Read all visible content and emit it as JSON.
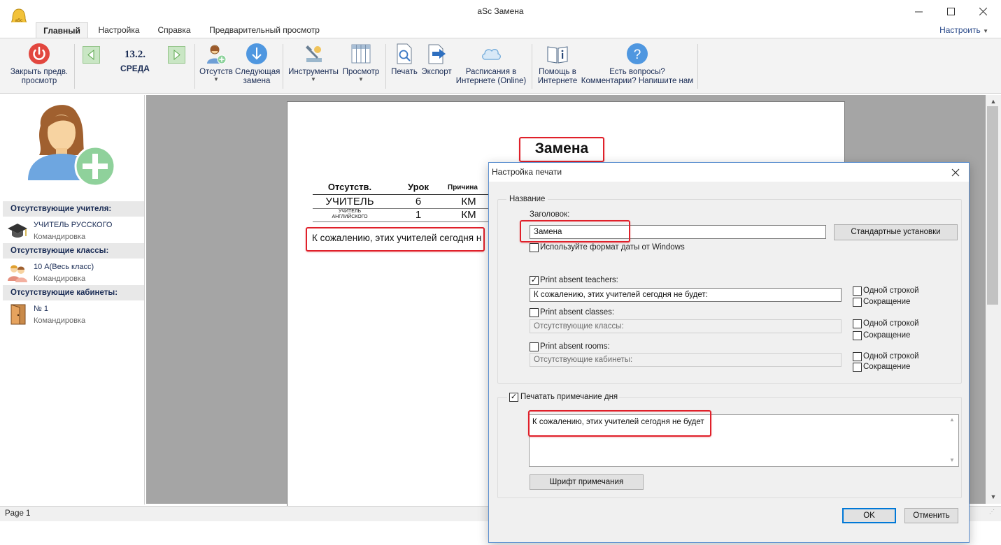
{
  "window": {
    "title": "aSc Замена"
  },
  "tabs": [
    "Главный",
    "Настройка",
    "Справка",
    "Предварительный просмотр"
  ],
  "customize_label": "Настроить",
  "ribbon": {
    "close_preview": [
      "Закрыть предв.",
      "просмотр"
    ],
    "date": "13.2.",
    "weekday": "СРЕДА",
    "absent": "Отсутств",
    "next_sub": [
      "Следующая",
      "замена"
    ],
    "tools": "Инструменты",
    "view": "Просмотр",
    "print": "Печать",
    "export": "Экспорт",
    "online": [
      "Расписания в",
      "Интернете (Online)"
    ],
    "help": [
      "Помощь в",
      "Интернете"
    ],
    "questions": [
      "Есть вопросы?",
      "Комментарии? Напишите нам"
    ]
  },
  "left_panel": {
    "sections": [
      {
        "header": "Отсутствующие учителя:",
        "name": "УЧИТЕЛЬ РУССКОГО",
        "reason": "Командировка"
      },
      {
        "header": "Отсутствующие классы:",
        "name": "10 А(Весь класс)",
        "reason": "Командировка"
      },
      {
        "header": "Отсутствующие  кабинеты:",
        "name": "№ 1",
        "reason": "Командировка"
      }
    ]
  },
  "page": {
    "title": "Замена",
    "headers": [
      "Отсутств.",
      "Урок",
      "Причина"
    ],
    "rows": [
      {
        "teacher": "УЧИТЕЛЬ",
        "lesson": "6",
        "reason": "КМ"
      },
      {
        "teacher": "УЧИТЕЛЬ АНГЛИЙСКОГО",
        "lesson": "1",
        "reason": "КМ"
      }
    ],
    "note": "К сожалению, этих учителей сегодня н"
  },
  "status": {
    "page": "Page 1"
  },
  "dialog": {
    "title": "Настройка печати",
    "group_name": "Название",
    "heading_label": "Заголовок:",
    "heading_value": "Замена",
    "defaults_button": "Стандартные установки",
    "windows_date": "Используйте формат даты от Windows",
    "teachers_label": "Print absent teachers:",
    "teachers_value": "К сожалению, этих учителей сегодня не будет:",
    "classes_label": "Print absent classes:",
    "classes_value": "Отсутствующие классы:",
    "rooms_label": "Print absent rooms:",
    "rooms_value": "Отсутствующие  кабинеты:",
    "one_line": "Одной строкой",
    "abbrev": "Сокращение",
    "print_note_label": "Печатать примечание дня",
    "note_text": "К сожалению, этих учителей сегодня не будет",
    "font_button": "Шрифт примечания",
    "ok": "OK",
    "cancel": "Отменить"
  }
}
